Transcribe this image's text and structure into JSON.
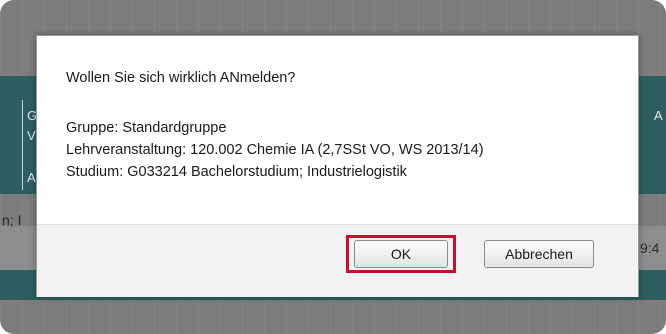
{
  "dialog": {
    "question": "Wollen Sie sich wirklich ANmelden?",
    "group": "Gruppe: Standardgruppe",
    "course": "Lehrveranstaltung: 120.002 Chemie IA (2,7SSt VO, WS 2013/14)",
    "study": "Studium: G033214 Bachelorstudium; Industrielogistik",
    "ok_label": "OK",
    "cancel_label": "Abbrechen"
  },
  "background": {
    "left_fragments": [
      "G",
      "V",
      "A",
      "n; I"
    ],
    "right_fragments": [
      "A",
      "9:4"
    ]
  },
  "colors": {
    "overlay": "#7c7c7c",
    "table_band": "#2d5d60",
    "highlight": "#c8102e"
  }
}
